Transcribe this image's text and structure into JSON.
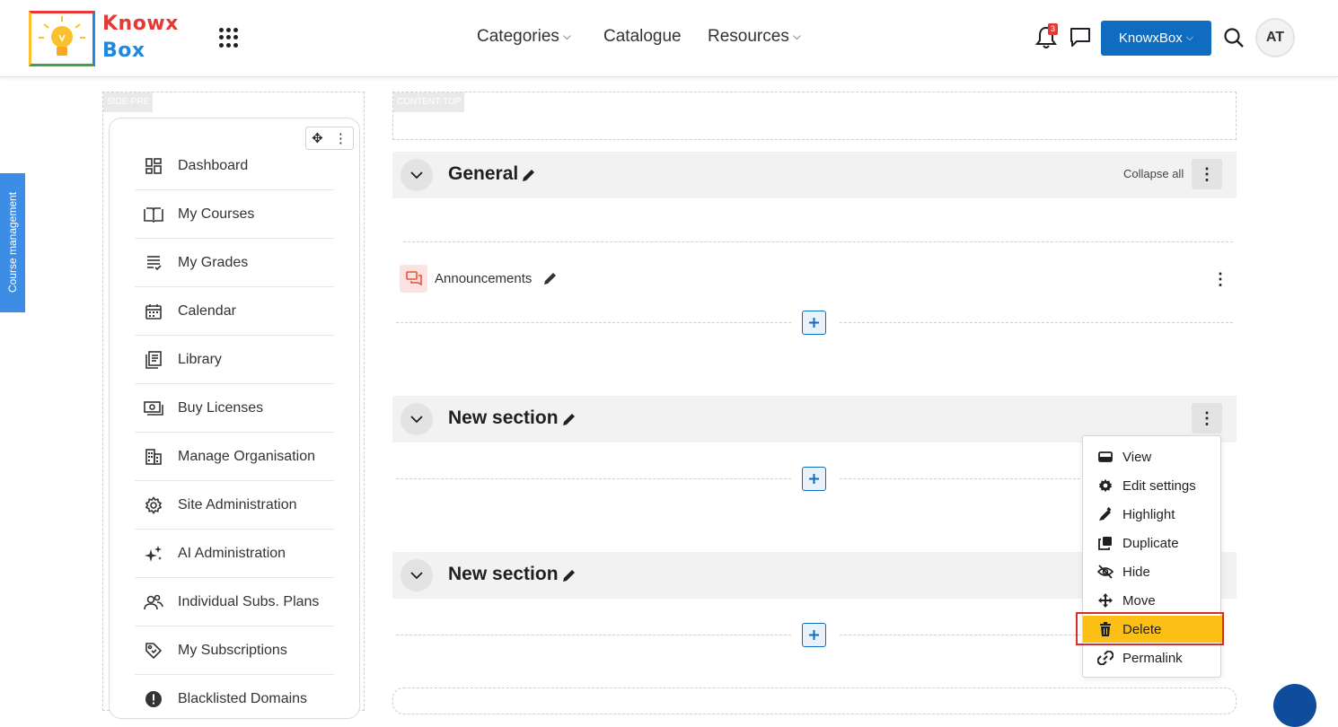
{
  "header": {
    "logo_line1": "Knowx",
    "logo_line2": "Box",
    "nav": [
      {
        "label": "Categories",
        "has_dropdown": true
      },
      {
        "label": "Catalogue",
        "has_dropdown": false
      },
      {
        "label": "Resources",
        "has_dropdown": true
      }
    ],
    "notification_count": "3",
    "org_button_label": "KnowxBox",
    "avatar_initials": "AT"
  },
  "drawer": {
    "label": "Course management"
  },
  "side_pre": {
    "region_label": "SIDE-PRE",
    "items": [
      {
        "label": "Dashboard",
        "icon": "dashboard-icon"
      },
      {
        "label": "My Courses",
        "icon": "book-icon"
      },
      {
        "label": "My Grades",
        "icon": "grades-icon"
      },
      {
        "label": "Calendar",
        "icon": "calendar-icon"
      },
      {
        "label": "Library",
        "icon": "library-icon"
      },
      {
        "label": "Buy Licenses",
        "icon": "money-icon"
      },
      {
        "label": "Manage Organisation",
        "icon": "building-icon"
      },
      {
        "label": "Site Administration",
        "icon": "gear-icon"
      },
      {
        "label": "AI Administration",
        "icon": "sparkle-icon"
      },
      {
        "label": "Individual Subs. Plans",
        "icon": "users-icon"
      },
      {
        "label": "My Subscriptions",
        "icon": "tag-icon"
      },
      {
        "label": "Blacklisted Domains",
        "icon": "alert-icon"
      }
    ]
  },
  "content": {
    "region_label": "CONTENT-TOP",
    "collapse_all_label": "Collapse all",
    "sections": [
      {
        "title": "General"
      },
      {
        "title": "New section"
      },
      {
        "title": "New section"
      }
    ],
    "activity": {
      "name": "Announcements",
      "icon": "forum-icon"
    }
  },
  "section_menu": {
    "items": [
      {
        "label": "View",
        "icon": "view-icon"
      },
      {
        "label": "Edit settings",
        "icon": "gear-icon"
      },
      {
        "label": "Highlight",
        "icon": "highlighter-icon"
      },
      {
        "label": "Duplicate",
        "icon": "copy-icon"
      },
      {
        "label": "Hide",
        "icon": "eye-slash-icon"
      },
      {
        "label": "Move",
        "icon": "move-icon"
      },
      {
        "label": "Delete",
        "icon": "trash-icon",
        "active": true
      },
      {
        "label": "Permalink",
        "icon": "link-icon"
      }
    ]
  },
  "colors": {
    "primary": "#0f6cbf",
    "drawer_tab": "#3d8de6",
    "active_item": "#fbbf16",
    "highlight_border": "#d32f2f",
    "badge": "#e53935"
  }
}
